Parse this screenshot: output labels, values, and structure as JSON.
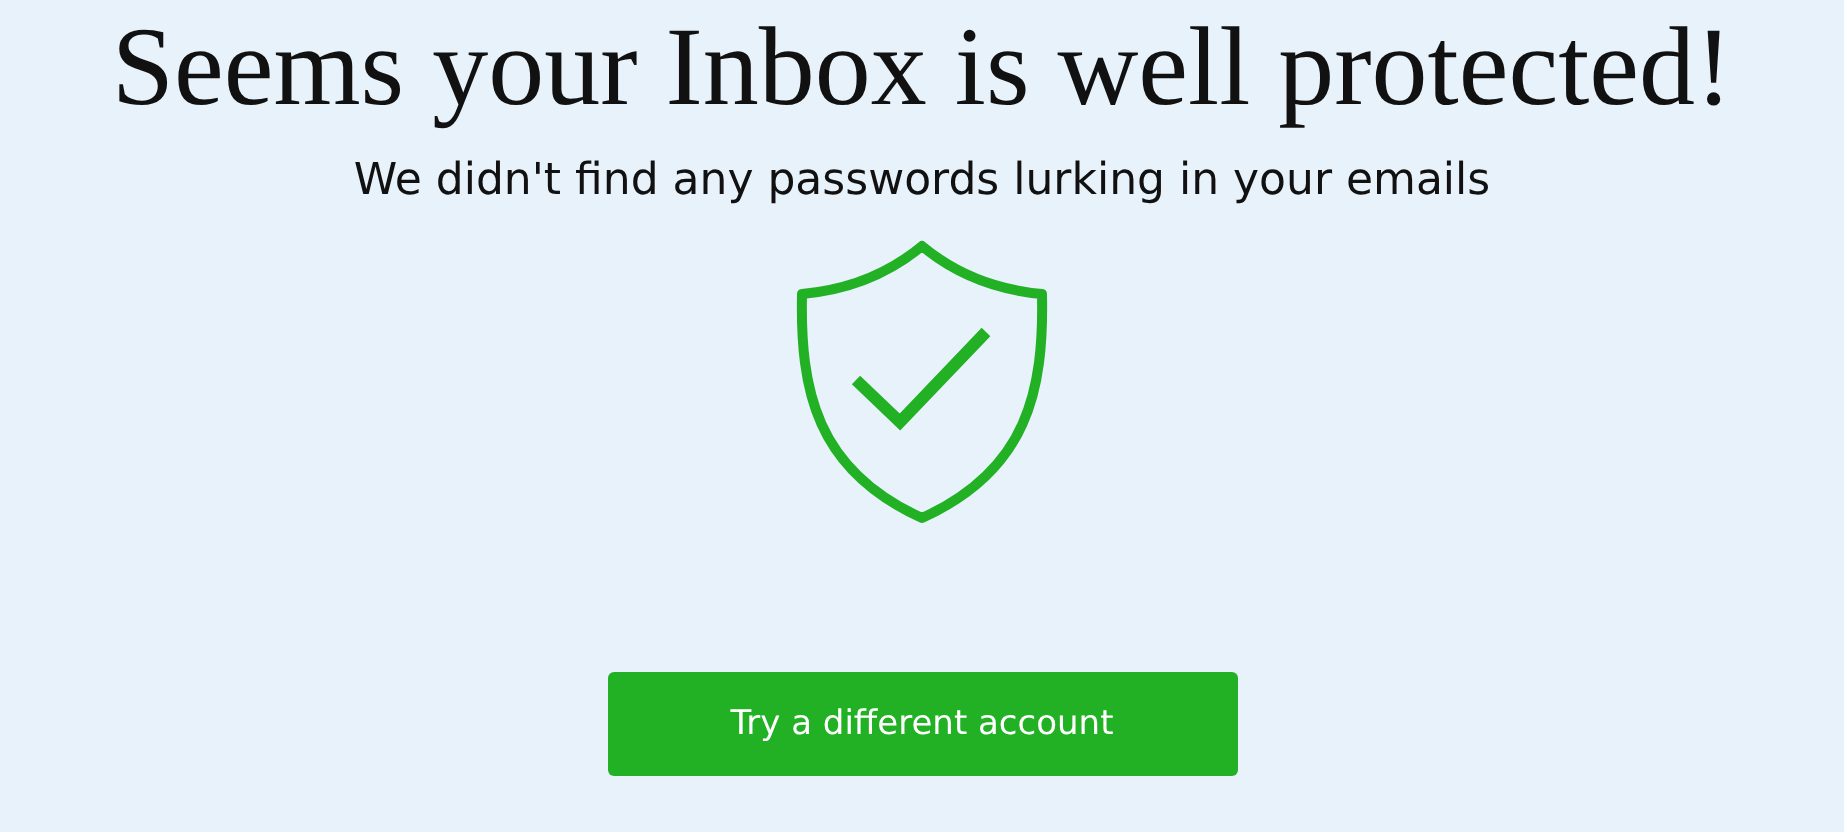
{
  "title": "Seems your Inbox is well protected!",
  "subtitle": "We didn't find any passwords lurking in your emails",
  "button": {
    "label": "Try a different account"
  }
}
